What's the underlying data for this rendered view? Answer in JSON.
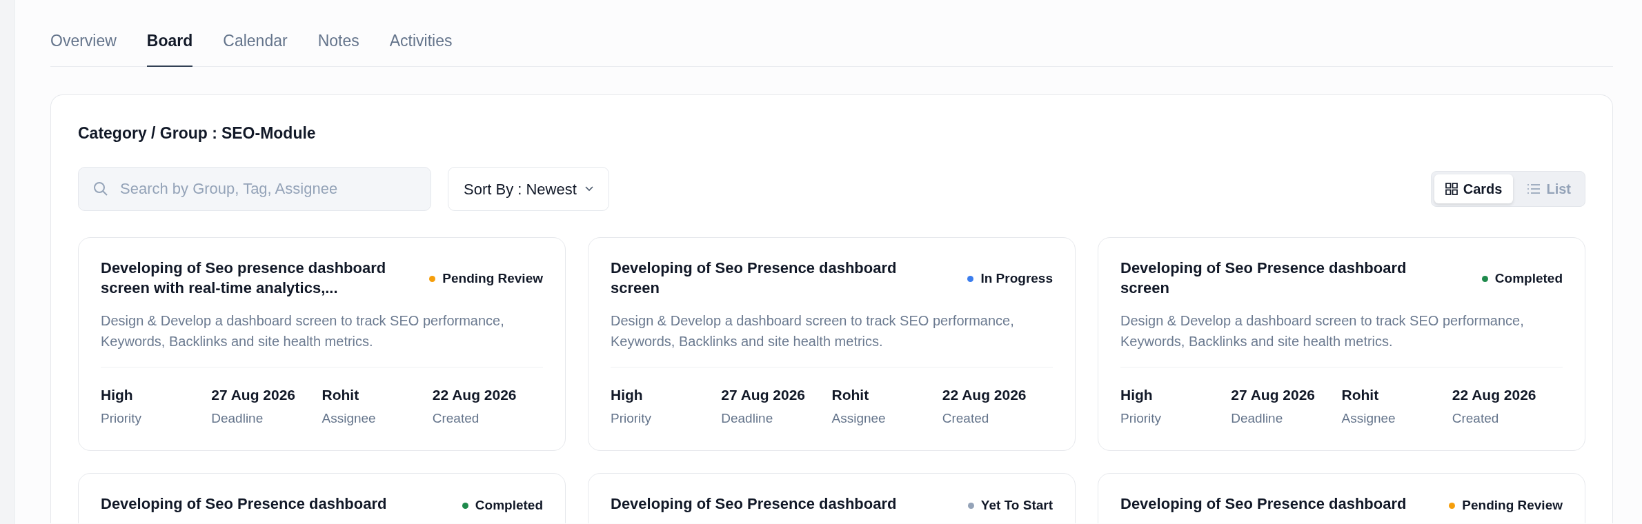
{
  "tabs": [
    {
      "label": "Overview",
      "selected": false
    },
    {
      "label": "Board",
      "selected": true
    },
    {
      "label": "Calendar",
      "selected": false
    },
    {
      "label": "Notes",
      "selected": false
    },
    {
      "label": "Activities",
      "selected": false
    }
  ],
  "header": {
    "label": "Category / Group :",
    "value": "SEO-Module"
  },
  "search": {
    "placeholder": "Search by Group, Tag, Assignee"
  },
  "sort": {
    "label": "Sort By : Newest"
  },
  "view_toggle": [
    {
      "label": "Cards",
      "kind": "grid",
      "selected": true
    },
    {
      "label": "List",
      "kind": "list",
      "selected": false
    }
  ],
  "cards": [
    {
      "title": "Developing of Seo presence dashboard screen with real-time analytics,...",
      "status": "Pending Review",
      "color": "#f59e0b",
      "description": "Design & Develop a dashboard screen to track SEO performance, Keywords, Backlinks and site health metrics.",
      "stats": [
        {
          "value": "High",
          "label": "Priority"
        },
        {
          "value": "27 Aug 2026",
          "label": "Deadline"
        },
        {
          "value": "Rohit",
          "label": "Assignee"
        },
        {
          "value": "22 Aug 2026",
          "label": "Created"
        }
      ]
    },
    {
      "title": "Developing of Seo Presence dashboard screen",
      "status": "In Progress",
      "color": "#3b7ded",
      "description": "Design & Develop a dashboard screen to track SEO performance, Keywords, Backlinks and site health metrics.",
      "stats": [
        {
          "value": "High",
          "label": "Priority"
        },
        {
          "value": "27 Aug 2026",
          "label": "Deadline"
        },
        {
          "value": "Rohit",
          "label": "Assignee"
        },
        {
          "value": "22 Aug 2026",
          "label": "Created"
        }
      ]
    },
    {
      "title": "Developing of Seo Presence dashboard screen",
      "status": "Completed",
      "color": "#1f8a4c",
      "description": "Design & Develop a dashboard screen to track SEO performance, Keywords, Backlinks and site health metrics.",
      "stats": [
        {
          "value": "High",
          "label": "Priority"
        },
        {
          "value": "27 Aug 2026",
          "label": "Deadline"
        },
        {
          "value": "Rohit",
          "label": "Assignee"
        },
        {
          "value": "22 Aug 2026",
          "label": "Created"
        }
      ]
    },
    {
      "title": "Developing of Seo Presence dashboard",
      "status": "Completed",
      "color": "#1f8a4c"
    },
    {
      "title": "Developing of Seo Presence dashboard",
      "status": "Yet To Start",
      "color": "#94a3b8"
    },
    {
      "title": "Developing of Seo Presence dashboard",
      "status": "Pending Review",
      "color": "#f59e0b"
    }
  ]
}
